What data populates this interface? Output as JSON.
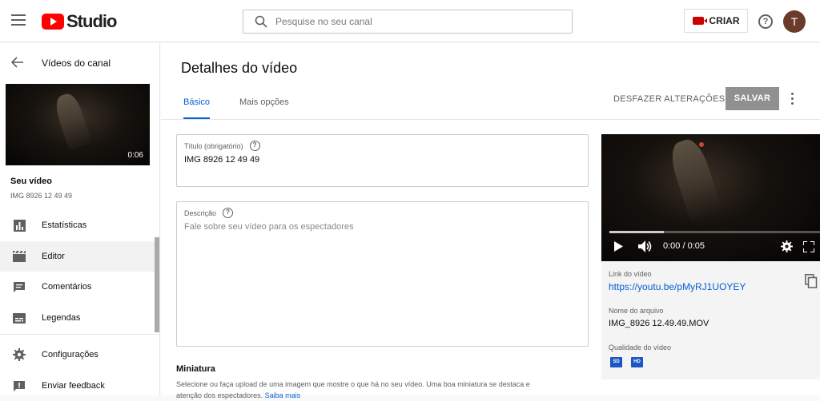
{
  "header": {
    "logo_text": "Studio",
    "search_placeholder": "Pesquise no seu canal",
    "create_label": "CRIAR",
    "help_glyph": "?",
    "avatar_letter": "T",
    "brand_color": "#ff0000"
  },
  "sidebar": {
    "back_label": "Vídeos do canal",
    "thumbnail_duration": "0:06",
    "video_heading": "Seu vídeo",
    "video_name": "IMG 8926 12 49 49",
    "items": [
      {
        "label": "Estatísticas",
        "icon": "bar-chart-icon"
      },
      {
        "label": "Editor",
        "icon": "clapperboard-icon",
        "active": true
      },
      {
        "label": "Comentários",
        "icon": "comment-icon"
      },
      {
        "label": "Legendas",
        "icon": "subtitles-icon"
      },
      {
        "label": "Configurações",
        "icon": "gear-icon"
      },
      {
        "label": "Enviar feedback",
        "icon": "feedback-icon"
      }
    ]
  },
  "main": {
    "title": "Detalhes do vídeo",
    "tabs": [
      {
        "label": "Básico",
        "active": true
      },
      {
        "label": "Mais opções",
        "active": false
      }
    ],
    "undo_label": "DESFAZER ALTERAÇÕES",
    "save_label": "SALVAR",
    "title_field": {
      "label": "Título (obrigatório)",
      "value": "IMG 8926 12 49 49"
    },
    "description_field": {
      "label": "Descrição",
      "placeholder": "Fale sobre seu vídeo para os espectadores"
    },
    "thumbnail_section": {
      "title": "Miniatura",
      "description_line1": "Selecione ou faça upload de uma imagem que mostre o que há no seu vídeo. Uma boa miniatura se destaca e",
      "description_line2": "atenção dos espectadores.",
      "learn_more": "Saiba mais"
    }
  },
  "player": {
    "time": "0:00 / 0:05",
    "progress": 0.26
  },
  "video_info": {
    "link_label": "Link do vídeo",
    "link_url": "https://youtu.be/pMyRJ1UOYEY",
    "filename_label": "Nome do arquivo",
    "filename": "IMG_8926 12.49.49.MOV",
    "quality_label": "Qualidade do vídeo",
    "quality_badges": [
      "SD",
      "HD"
    ]
  }
}
